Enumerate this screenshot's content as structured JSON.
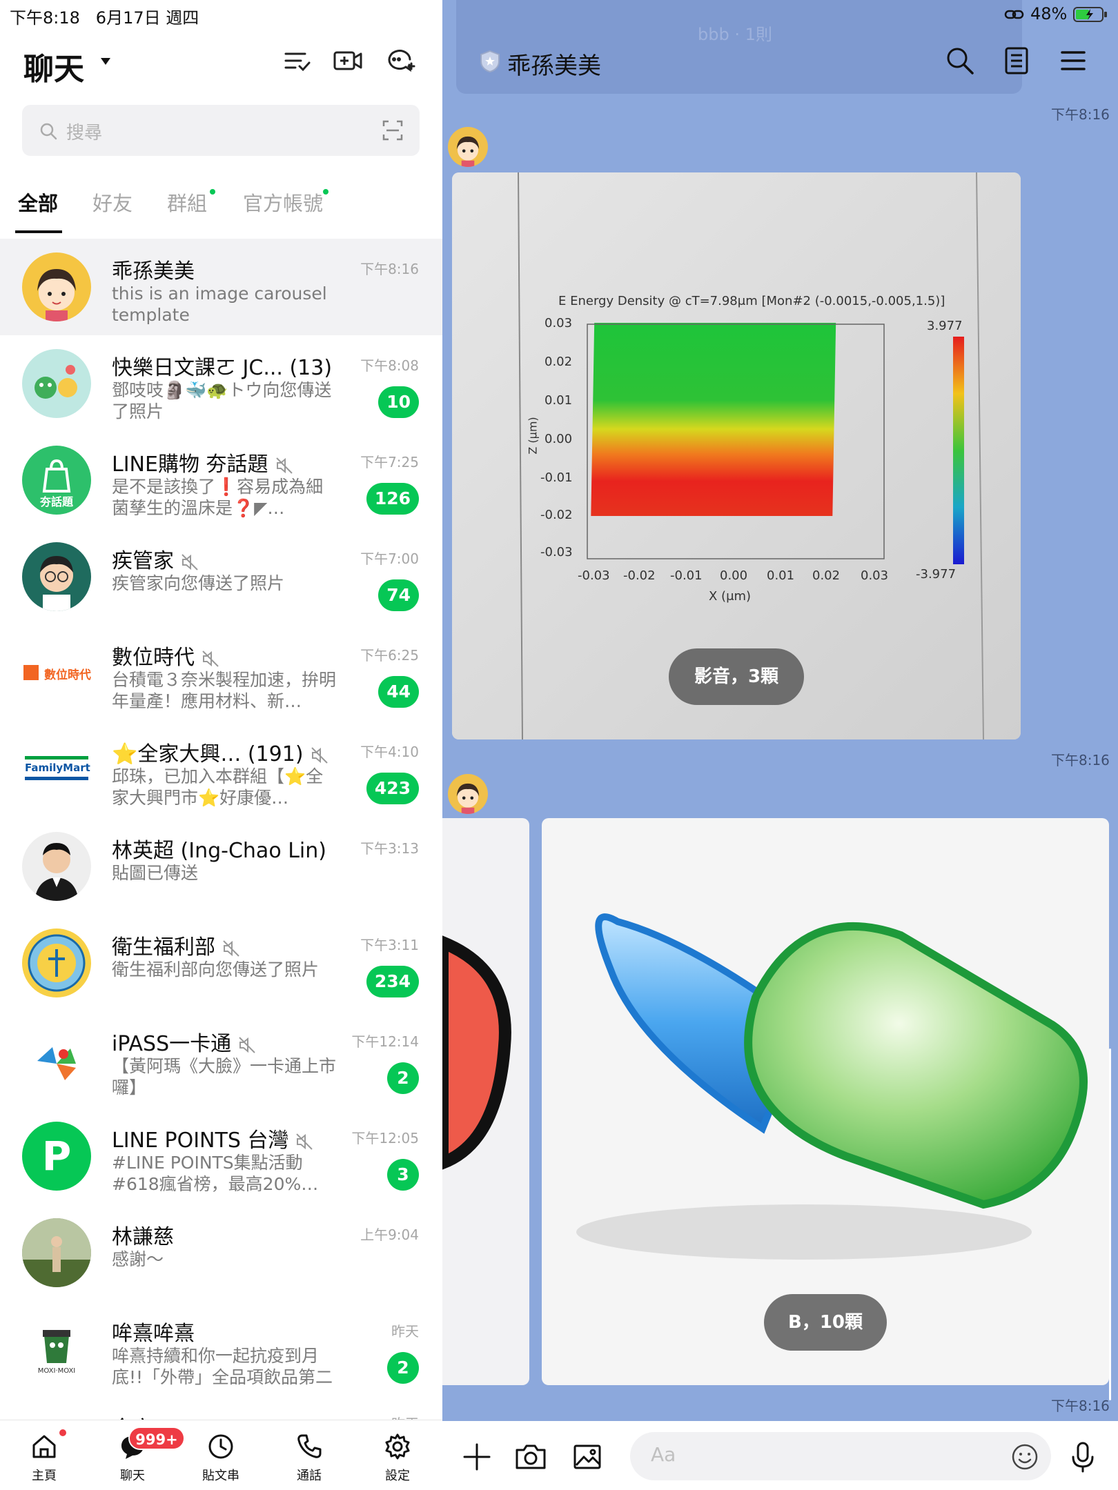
{
  "status": {
    "time": "下午8:18",
    "date": "6月17日 週四",
    "battery": "48%"
  },
  "header": {
    "title": "聊天"
  },
  "search": {
    "placeholder": "搜尋"
  },
  "tabs": [
    "全部",
    "好友",
    "群組",
    "官方帳號"
  ],
  "chats": [
    {
      "name": "乖孫美美",
      "message": "this is an image carousel template",
      "time": "下午8:16",
      "badge": ""
    },
    {
      "name": "快樂日文課ㄛ JC... (13)",
      "message": "鄧吱吱🗿🐳🐢トウ向您傳送了照片",
      "time": "下午8:08",
      "badge": "10"
    },
    {
      "name": "LINE購物 夯話題",
      "message": "是不是該換了❗容易成為細菌孳生的溫床是❓◤…",
      "time": "下午7:25",
      "badge": "126"
    },
    {
      "name": "疾管家",
      "message": "疾管家向您傳送了照片",
      "time": "下午7:00",
      "badge": "74"
    },
    {
      "name": "數位時代",
      "message": "台積電３奈米製程加速，拚明年量產！應用材料、新…",
      "time": "下午6:25",
      "badge": "44"
    },
    {
      "name": "⭐全家大興… (191)",
      "message": "邱珠，已加入本群組【⭐全家大興門市⭐好康優…",
      "time": "下午4:10",
      "badge": "423"
    },
    {
      "name": "林英超 (Ing-Chao Lin)",
      "message": "貼圖已傳送",
      "time": "下午3:13",
      "badge": ""
    },
    {
      "name": "衛生福利部",
      "message": "衛生福利部向您傳送了照片",
      "time": "下午3:11",
      "badge": "234"
    },
    {
      "name": "iPASS一卡通",
      "message": "【黃阿瑪《大臉》一卡通上市囉】",
      "time": "下午12:14",
      "badge": "2"
    },
    {
      "name": "LINE POINTS 台灣",
      "message": "#LINE POINTS集點活動#618瘋省榜，最高20%…",
      "time": "下午12:05",
      "badge": "3"
    },
    {
      "name": "林謙慈",
      "message": "感謝～",
      "time": "上午9:04",
      "badge": ""
    },
    {
      "name": "哞熹哞熹",
      "message": "哞熹持續和你一起抗疫到月底!!「外帶」全品項飲品第二杯…",
      "time": "昨天",
      "badge": "2"
    },
    {
      "name": "全家 FamilyMart",
      "message": "",
      "time": "昨天",
      "badge": ""
    }
  ],
  "avatar_texts": {
    "line_shopping": "夯話題",
    "bnext": "數位時代",
    "familymart": "FamilyMart",
    "moxi": "MOXI·MOXI",
    "points": "P"
  },
  "nav": {
    "home": "主頁",
    "chat": "聊天",
    "timeline": "貼文串",
    "calls": "通話",
    "settings": "設定",
    "badge": "999+"
  },
  "conversation": {
    "title": "乖孫美美",
    "faded_banner": "bbb · 1則",
    "time1": "下午8:16",
    "time2": "下午8:16",
    "time3": "下午8:16",
    "card1_label": "影音，3顆",
    "card2_label": "B，10顆",
    "input_placeholder": "Aa"
  },
  "photo_chart": {
    "title": "E Energy Density @ cT=7.98μm [Mon#2 (-0.0015,-0.005,1.5)]",
    "xlabel": "X (μm)",
    "ylabel": "Z (μm)",
    "xticks": [
      "-0.03",
      "-0.02",
      "-0.01",
      "0.00",
      "0.01",
      "0.02",
      "0.03"
    ],
    "yticks": [
      "0.03",
      "0.02",
      "0.01",
      "0.00",
      "-0.01",
      "-0.02",
      "-0.03"
    ],
    "cbar_max": "3.977",
    "cbar_min": "-3.977"
  },
  "colors": {
    "accent": "#06c755",
    "chat_bg": "#8ca8dc",
    "badge_red": "#ee3b44"
  }
}
